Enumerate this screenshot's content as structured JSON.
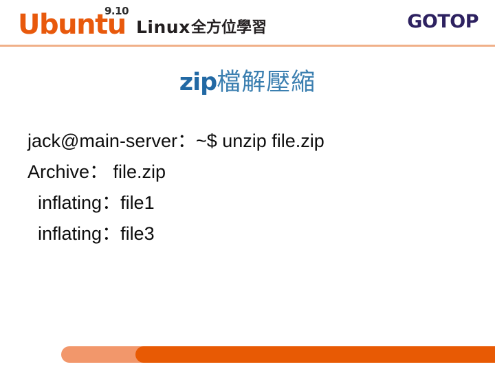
{
  "header": {
    "brand": "Ubuntu",
    "version": "9.10",
    "subtitle_latin": "Linux",
    "subtitle_cjk": "全方位學習",
    "publisher": "GOTOP"
  },
  "slide": {
    "title_latin": "zip",
    "title_cjk": "檔解壓縮",
    "lines": [
      {
        "text": "jack@main-server：~$ unzip file.zip",
        "indent": 0
      },
      {
        "text": "Archive： file.zip",
        "indent": 0
      },
      {
        "text": "inflating：file1",
        "indent": 1
      },
      {
        "text": "inflating：file3",
        "indent": 1
      }
    ]
  },
  "colors": {
    "ubuntu_orange": "#e8590c",
    "title_blue": "#2269a4",
    "title_cjk_blue": "#3b7fb0",
    "publisher_navy": "#2d2160",
    "rule_peach": "#f0b089",
    "bar_light_orange": "#f2976b",
    "bar_dark_orange": "#e85a04"
  }
}
